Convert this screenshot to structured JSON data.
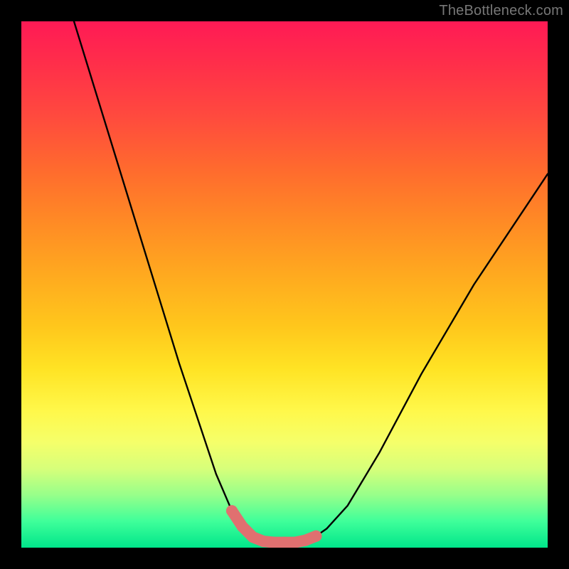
{
  "watermark": "TheBottleneck.com",
  "chart_data": {
    "type": "line",
    "title": "",
    "xlabel": "",
    "ylabel": "",
    "xlim": [
      0,
      100
    ],
    "ylim": [
      0,
      100
    ],
    "series": [
      {
        "name": "curve",
        "color": "#000000",
        "stroke_width": 2.4,
        "x": [
          10,
          14,
          18,
          22,
          26,
          30,
          34,
          37,
          40,
          42,
          44,
          46,
          48,
          50,
          52,
          54,
          56,
          58,
          62,
          68,
          76,
          86,
          98,
          100
        ],
        "y": [
          100,
          87,
          74,
          61,
          48,
          35,
          23,
          14,
          7,
          4,
          2,
          1.2,
          1,
          1,
          1,
          1.4,
          2.2,
          3.6,
          8,
          18,
          33,
          50,
          68,
          71
        ]
      },
      {
        "name": "valley-markers",
        "color": "#e07070",
        "marker_radius": 8,
        "stroke_width": 16,
        "x": [
          40,
          42,
          44,
          46,
          48,
          50,
          52,
          54,
          56
        ],
        "y": [
          7,
          4,
          2,
          1.2,
          1,
          1,
          1,
          1.4,
          2.2
        ]
      }
    ]
  }
}
